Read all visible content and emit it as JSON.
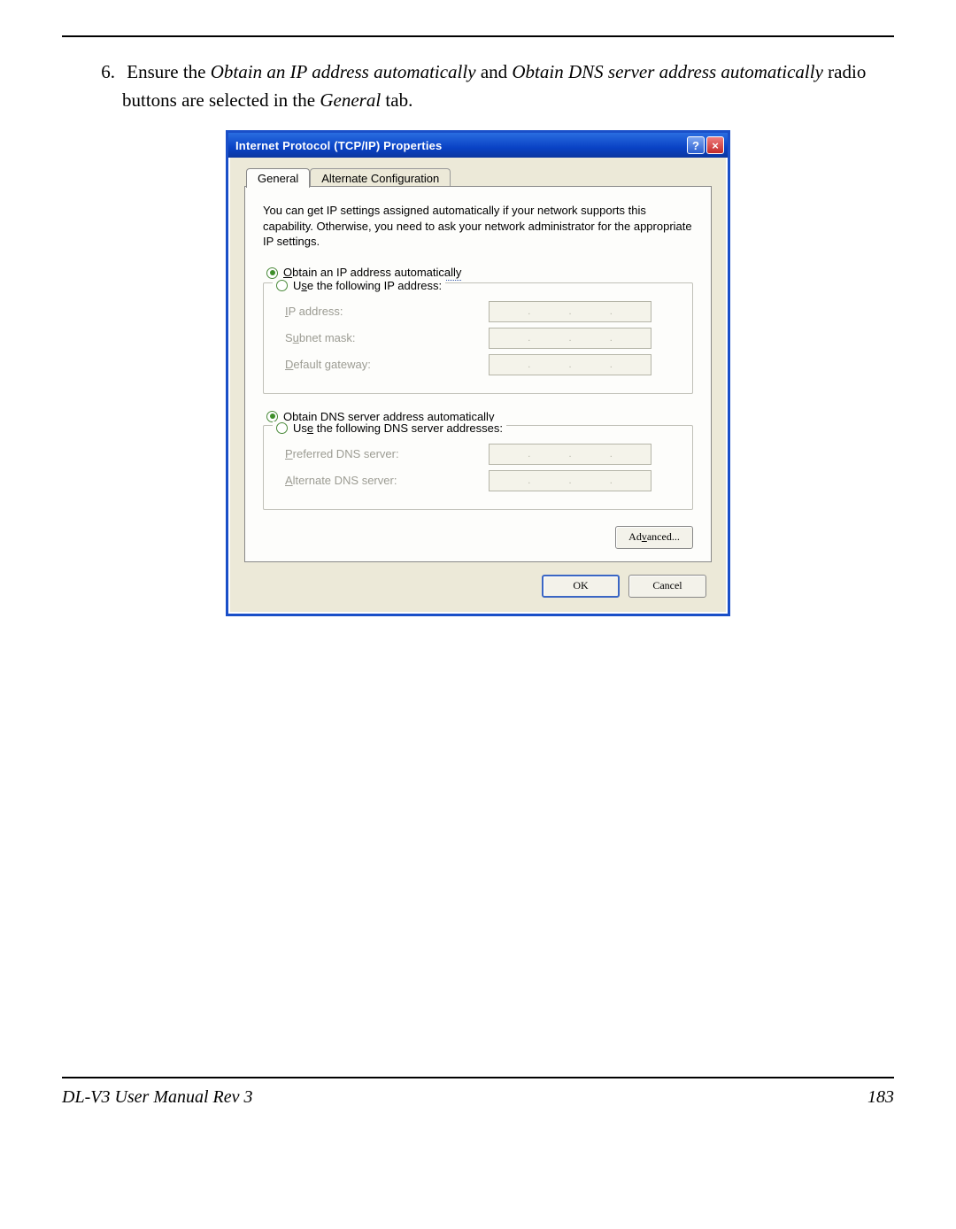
{
  "instruction": {
    "number": "6.",
    "pre": "Ensure the ",
    "em1": "Obtain an IP address automatically",
    "mid": " and ",
    "em2": "Obtain DNS server address automatically",
    "post1": " radio buttons are selected in the ",
    "em3": "General",
    "post2": " tab."
  },
  "dialog": {
    "title": "Internet Protocol (TCP/IP) Properties",
    "tabs": {
      "general": "General",
      "alt": "Alternate Configuration"
    },
    "intro": "You can get IP settings assigned automatically if your network supports this capability. Otherwise, you need to ask your network administrator for the appropriate IP settings.",
    "ip": {
      "radio_auto_pre": "O",
      "radio_auto_mid": "btain an IP address automatically",
      "radio_static_pre": "U",
      "radio_static_s": "s",
      "radio_static_post": "e the following IP address:",
      "ip_label_pre": "I",
      "ip_label_post": "P address:",
      "subnet_label_pre": "S",
      "subnet_label_u": "u",
      "subnet_label_post": "bnet mask:",
      "gw_label_pre": "D",
      "gw_label_post": "efault gateway:"
    },
    "dns": {
      "radio_auto_pre": "O",
      "radio_auto_b": "b",
      "radio_auto_post": "tain DNS server address automatically",
      "radio_static_pre": "Us",
      "radio_static_e": "e",
      "radio_static_post": " the following DNS server addresses:",
      "pref_label_pre": "P",
      "pref_label_post": "referred DNS server:",
      "alt_label_pre": "A",
      "alt_label_post": "lternate DNS server:"
    },
    "buttons": {
      "advanced_pre": "Ad",
      "advanced_v": "v",
      "advanced_post": "anced...",
      "ok": "OK",
      "cancel": "Cancel"
    }
  },
  "footer": {
    "left": "DL-V3 User Manual Rev 3",
    "right": "183"
  }
}
